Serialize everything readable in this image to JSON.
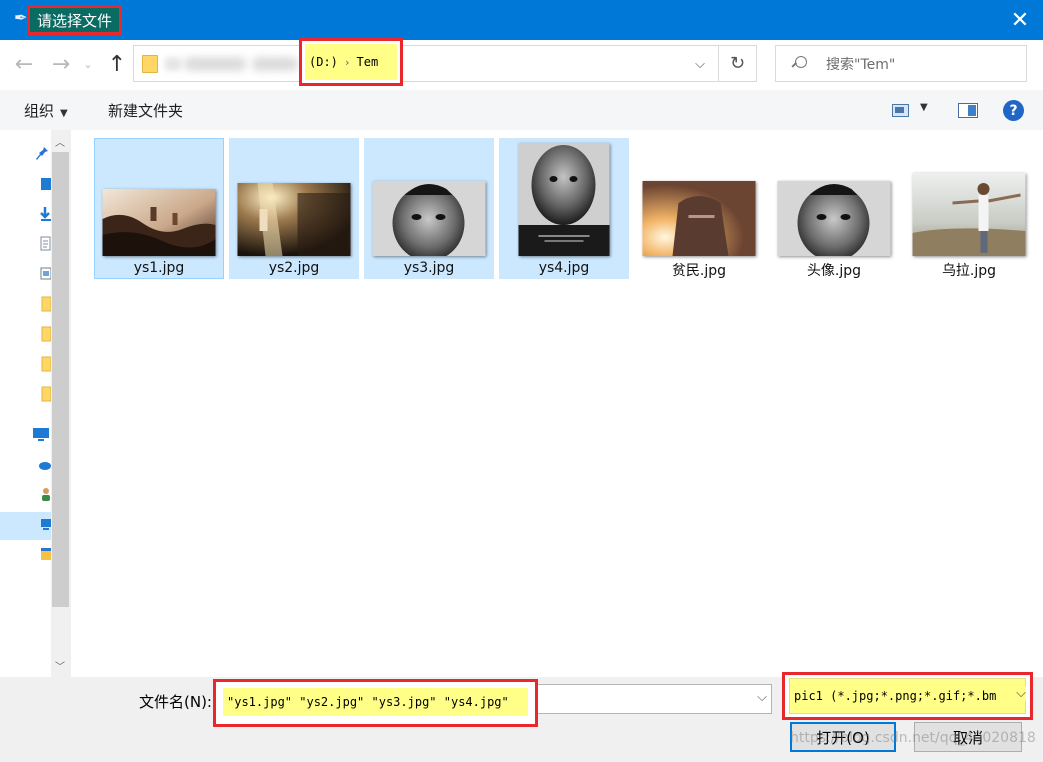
{
  "window": {
    "title": "请选择文件",
    "close_glyph": "✕"
  },
  "nav": {
    "back_icon": "arrow-left-icon",
    "forward_icon": "arrow-right-icon",
    "up_icon": "arrow-up-icon"
  },
  "address": {
    "drive": "(D:)",
    "folder": "Tem",
    "separator": "›"
  },
  "search": {
    "placeholder": "搜索\"Tem\""
  },
  "toolbar": {
    "organize_label": "组织",
    "new_folder_label": "新建文件夹",
    "help_label": "?"
  },
  "files": [
    {
      "name": "ys1.jpg",
      "selected": true,
      "focused": true
    },
    {
      "name": "ys2.jpg",
      "selected": true,
      "focused": false
    },
    {
      "name": "ys3.jpg",
      "selected": true,
      "focused": false
    },
    {
      "name": "ys4.jpg",
      "selected": true,
      "focused": false
    },
    {
      "name": "贫民.jpg",
      "selected": false,
      "focused": false
    },
    {
      "name": "头像.jpg",
      "selected": false,
      "focused": false
    },
    {
      "name": "乌拉.jpg",
      "selected": false,
      "focused": false
    }
  ],
  "bottom": {
    "filename_label": "文件名(N):",
    "filename_value": "\"ys1.jpg\" \"ys2.jpg\" \"ys3.jpg\" \"ys4.jpg\"",
    "filetype_value": "pic1 (*.jpg;*.png;*.gif;*.bm",
    "open_label": "打开(O)",
    "cancel_label": "取消"
  },
  "watermark": "https://blog.csdn.net/qq_40020818",
  "colors": {
    "titlebar": "#0078d7",
    "highlight_box": "#e8282d",
    "highlight_fill": "#ffff88",
    "selection": "#cce8ff"
  }
}
